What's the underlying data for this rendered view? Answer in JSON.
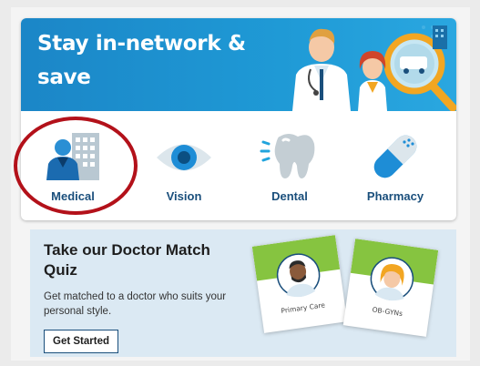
{
  "banner": {
    "title": "Stay in-network & save",
    "tiles": [
      {
        "label": "Medical",
        "icon": "doctor-building-icon"
      },
      {
        "label": "Vision",
        "icon": "eye-icon"
      },
      {
        "label": "Dental",
        "icon": "tooth-icon"
      },
      {
        "label": "Pharmacy",
        "icon": "pill-capsule-icon"
      }
    ],
    "highlighted_tile": "Medical"
  },
  "quiz": {
    "title": "Take our Doctor Match Quiz",
    "description": "Get matched to a doctor who suits your personal style.",
    "button_label": "Get Started",
    "cards": [
      {
        "label": "Primary Care",
        "icon": "male-doctor-avatar"
      },
      {
        "label": "OB-GYNs",
        "icon": "female-doctor-avatar"
      }
    ]
  },
  "colors": {
    "banner_blue": "#1f9ad6",
    "label_navy": "#1a4f7c",
    "highlight_red": "#b3111a",
    "quiz_bg": "#dbe9f3",
    "card_green": "#86c440"
  }
}
